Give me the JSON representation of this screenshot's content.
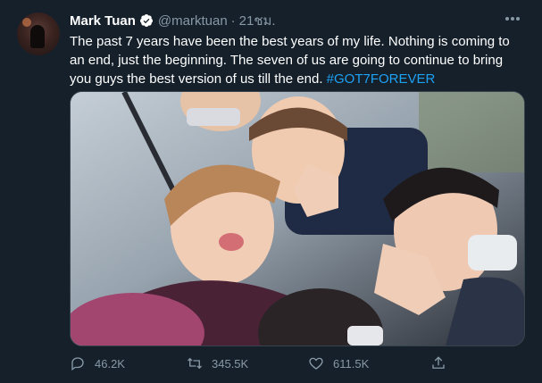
{
  "tweet": {
    "name": "Mark Tuan",
    "handle": "@marktuan",
    "separator": "·",
    "time": "21ชม.",
    "text_main": "The past 7 years have been the best years of my life. Nothing is coming to an end, just the beginning. The seven of us are going to continue to bring you guys the best version of us till the end. ",
    "hashtag": "#GOT7FOREVER",
    "colors": {
      "background": "#15202b",
      "muted": "#8899a6",
      "link": "#1da1f2",
      "border": "#38444d"
    }
  },
  "actions": {
    "reply": {
      "icon": "reply-icon",
      "count": "46.2K"
    },
    "retweet": {
      "icon": "retweet-icon",
      "count": "345.5K"
    },
    "like": {
      "icon": "heart-icon",
      "count": "611.5K"
    },
    "share": {
      "icon": "share-icon"
    }
  }
}
